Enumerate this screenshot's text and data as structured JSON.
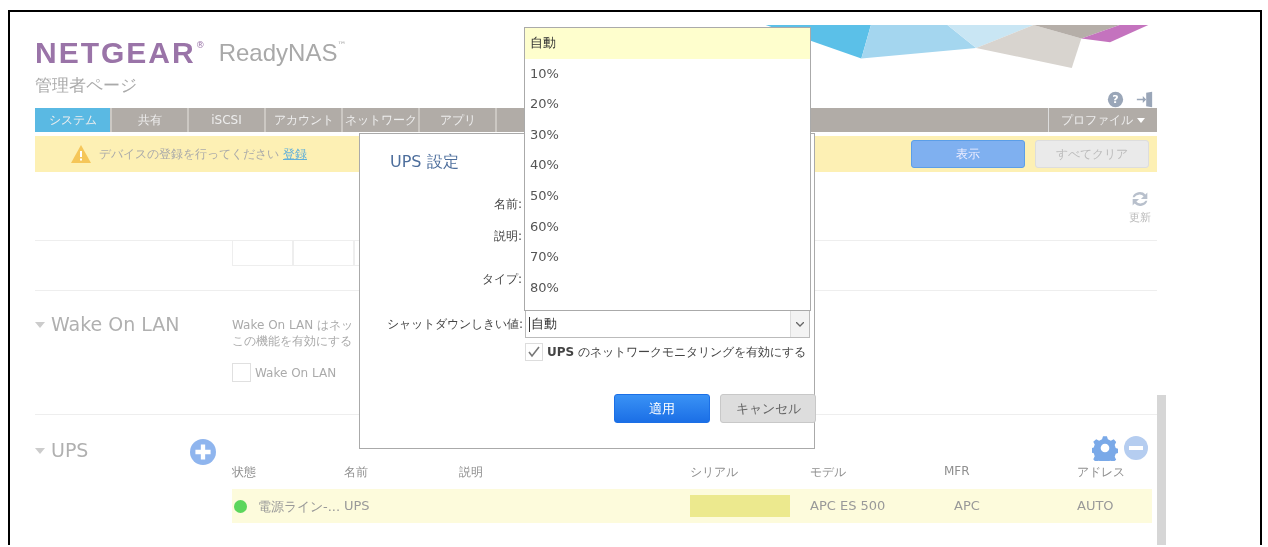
{
  "brand": {
    "logo": "NETGEAR",
    "registered": "®",
    "product": "ReadyNAS",
    "trademark": "™",
    "subtitle": "管理者ページ"
  },
  "tabs": [
    {
      "label": "システム",
      "selected": true
    },
    {
      "label": "共有",
      "selected": false
    },
    {
      "label": "iSCSI",
      "selected": false
    },
    {
      "label": "アカウント",
      "selected": false
    },
    {
      "label": "ネットワーク",
      "selected": false
    },
    {
      "label": "アプリ",
      "selected": false
    }
  ],
  "profile_menu": {
    "label": "プロファイル"
  },
  "notice": {
    "text": "デバイスの登録を行ってください",
    "link": "登録"
  },
  "notice_buttons": [
    {
      "label": "表示",
      "disabled": false
    },
    {
      "label": "すべてクリア",
      "disabled": true
    }
  ],
  "refresh": {
    "label": "更新"
  },
  "help_icon": "?",
  "wake_on_lan": {
    "title": "Wake On LAN",
    "expanded": true,
    "description": [
      "Wake On LAN はネッ",
      "この機能を有効にする"
    ],
    "checkbox": {
      "label": "Wake On LAN",
      "checked": false
    }
  },
  "ups": {
    "title": "UPS",
    "expanded": true,
    "columns": [
      "状態",
      "名前",
      "説明",
      "シリアル",
      "モデル",
      "MFR",
      "アドレス"
    ],
    "rows": [
      {
        "color": "#5cd65c",
        "status": "電源ライン-...",
        "name": "UPS",
        "model": "APC ES 500",
        "mfr": "APC",
        "address": "AUTO",
        "selected": true
      }
    ]
  },
  "dialog": {
    "title": "UPS 設定",
    "labels": [
      "名前:",
      "説明:",
      "タイプ:"
    ],
    "threshold": {
      "label": "シャットダウンしきい値:",
      "value": "自動"
    },
    "monitoring": {
      "label": "**UPS** のネットワークモニタリングを有効にする",
      "checked": true
    },
    "buttons": [
      {
        "label": "適用",
        "kind": "primary"
      },
      {
        "label": "キャンセル",
        "kind": "secondary"
      }
    ]
  },
  "dropdown": [
    {
      "label": "自動",
      "selected": true
    },
    {
      "label": "10%",
      "selected": false
    },
    {
      "label": "20%",
      "selected": false
    },
    {
      "label": "30%",
      "selected": false
    },
    {
      "label": "40%",
      "selected": false
    },
    {
      "label": "50%",
      "selected": false
    },
    {
      "label": "60%",
      "selected": false
    },
    {
      "label": "70%",
      "selected": false
    },
    {
      "label": "80%",
      "selected": false
    }
  ]
}
